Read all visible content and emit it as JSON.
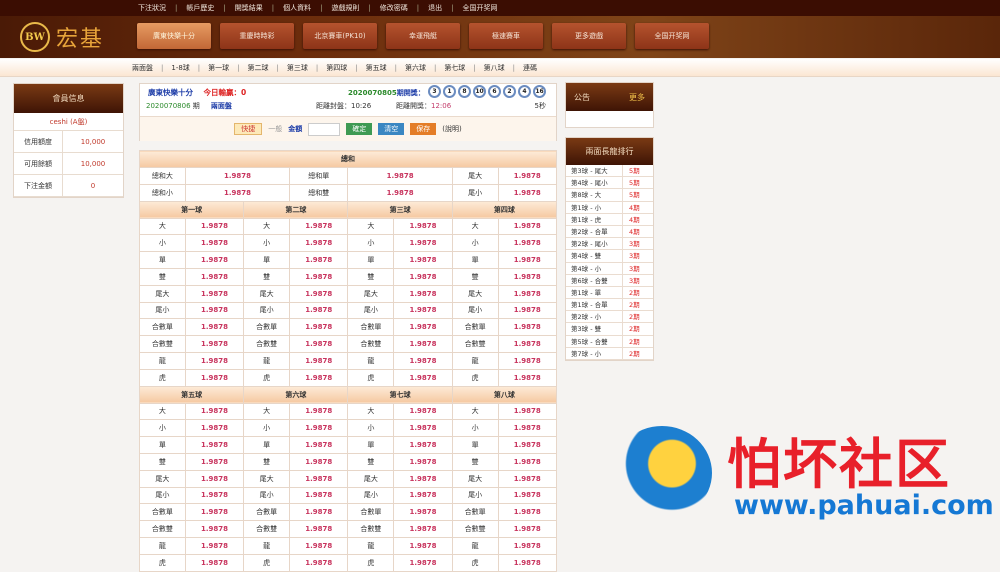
{
  "top_links": [
    "下注狀況",
    "帳戶歷史",
    "開獎結果",
    "個人資料",
    "遊戲規則",
    "修改密碼",
    "退出",
    "全国开奖网"
  ],
  "logo": {
    "badge": "BW",
    "name": "宏基"
  },
  "nav": [
    "廣東快樂十分",
    "重慶時時彩",
    "北京賽車(PK10)",
    "幸運飛艇",
    "極速賽車",
    "更多遊戲",
    "全国开奖网"
  ],
  "subnav": [
    "兩面盤",
    "1-8球",
    "第一球",
    "第二球",
    "第三球",
    "第四球",
    "第五球",
    "第六球",
    "第七球",
    "第八球",
    "連碼"
  ],
  "member": {
    "title": "會員信息",
    "user": "ceshi (A盤)",
    "rows": [
      {
        "k": "信用額度",
        "v": "10,000"
      },
      {
        "k": "可用餘額",
        "v": "10,000"
      },
      {
        "k": "下注金額",
        "v": "0"
      }
    ]
  },
  "info": {
    "game": "廣東快樂十分",
    "today_label": "今日輸贏：0",
    "last_issue": "2020070805",
    "last_label": "期開獎：",
    "balls": [
      "3",
      "1",
      "8",
      "10",
      "6",
      "2",
      "4",
      "16"
    ],
    "cur_issue": "2020070806",
    "cur_label": "期",
    "play": "兩面盤",
    "close_label": "距離封盤：",
    "close": "10:26",
    "open_label": "距離開獎：",
    "open": "12:06",
    "refresh": "5秒"
  },
  "betbar": {
    "quick": "快捷",
    "normal": "一般",
    "amount_label": "金額",
    "amount_value": "",
    "confirm": "確定",
    "clear": "清空",
    "save": "保存",
    "help": "(說明)"
  },
  "sum": {
    "title": "總和",
    "cells": [
      [
        "總和大",
        "1.9878",
        "總和單",
        "1.9878",
        "尾大",
        "1.9878"
      ],
      [
        "總和小",
        "1.9878",
        "總和雙",
        "1.9878",
        "尾小",
        "1.9878"
      ]
    ]
  },
  "balls_groups": [
    [
      "第一球",
      "第二球",
      "第三球",
      "第四球"
    ],
    [
      "第五球",
      "第六球",
      "第七球",
      "第八球"
    ]
  ],
  "bet_items": [
    "大",
    "小",
    "單",
    "雙",
    "尾大",
    "尾小",
    "合數單",
    "合數雙",
    "龍",
    "虎"
  ],
  "odds": "1.9878",
  "notice": {
    "title": "公告",
    "more": "更多"
  },
  "rank": {
    "title": "兩面長龍排行",
    "rows": [
      [
        "第3球 - 尾大",
        "5期"
      ],
      [
        "第4球 - 尾小",
        "5期"
      ],
      [
        "第8球 - 大",
        "5期"
      ],
      [
        "第1球 - 小",
        "4期"
      ],
      [
        "第1球 - 虎",
        "4期"
      ],
      [
        "第2球 - 合單",
        "4期"
      ],
      [
        "第2球 - 尾小",
        "3期"
      ],
      [
        "第4球 - 雙",
        "3期"
      ],
      [
        "第4球 - 小",
        "3期"
      ],
      [
        "第6球 - 合雙",
        "3期"
      ],
      [
        "第1球 - 單",
        "2期"
      ],
      [
        "第1球 - 合單",
        "2期"
      ],
      [
        "第2球 - 小",
        "2期"
      ],
      [
        "第3球 - 雙",
        "2期"
      ],
      [
        "第5球 - 合雙",
        "2期"
      ],
      [
        "第7球 - 小",
        "2期"
      ]
    ]
  },
  "watermark": {
    "title": "怕坏社区",
    "url": "www.pahuai.com"
  }
}
